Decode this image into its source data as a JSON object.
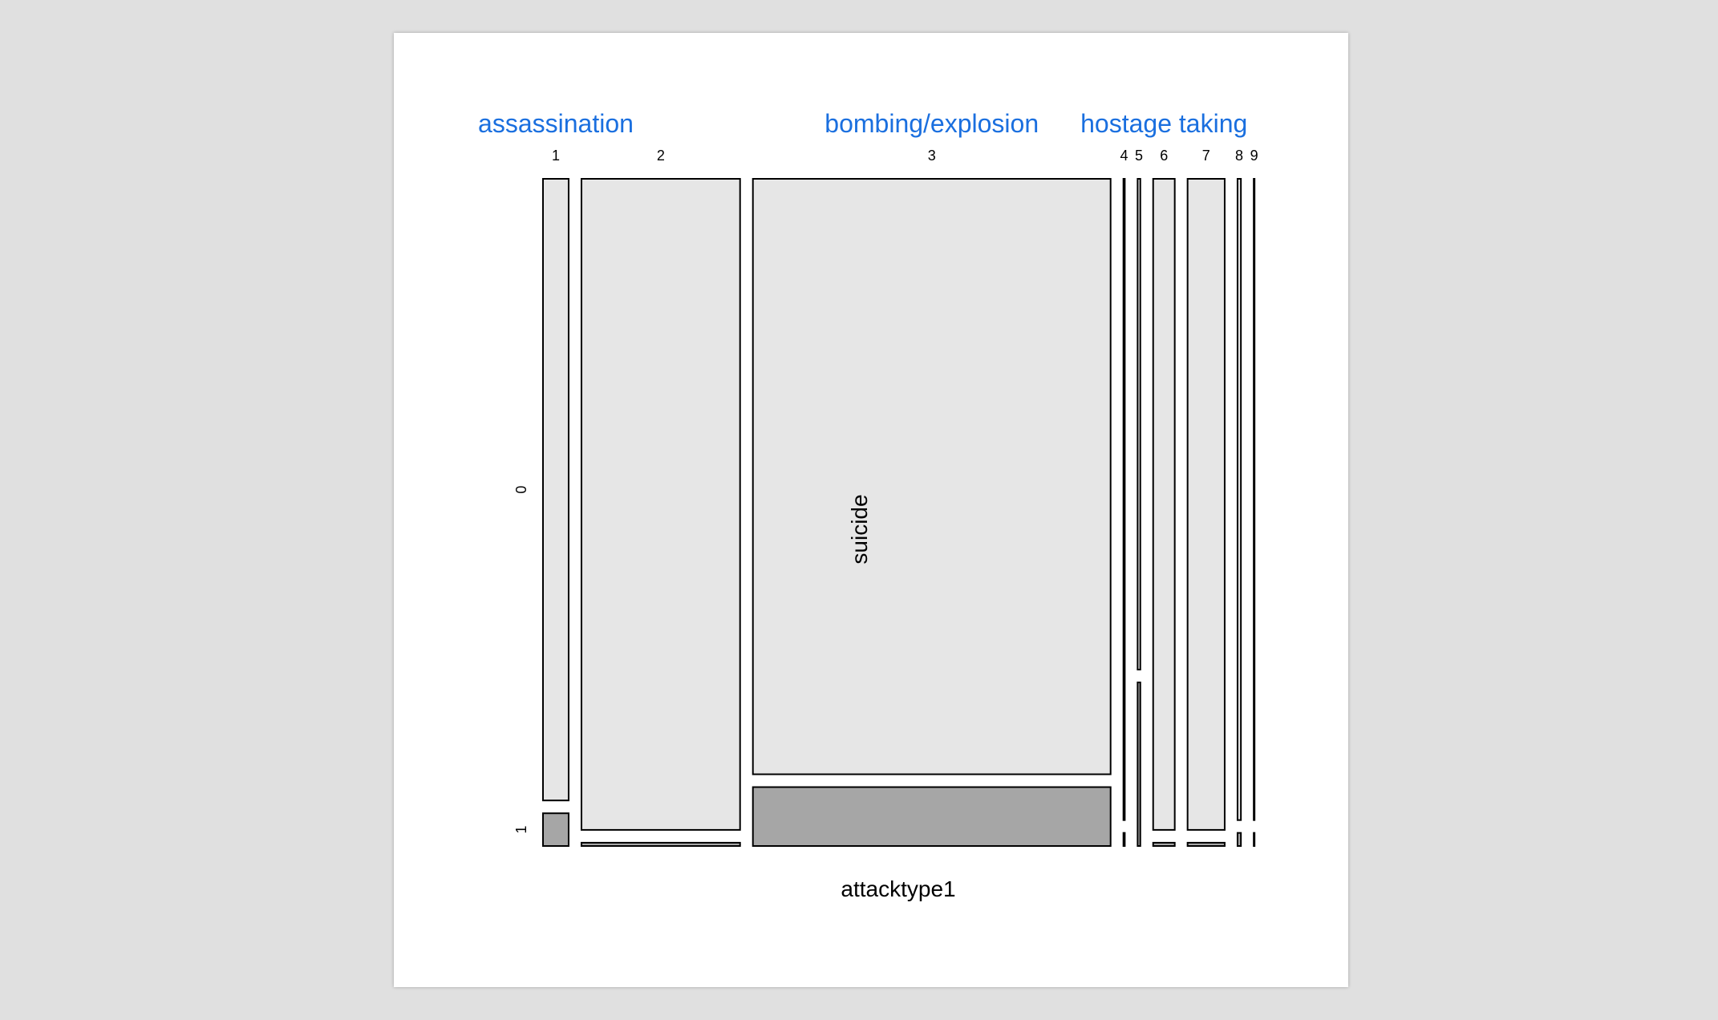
{
  "chart_data": {
    "type": "mosaic",
    "xlabel": "attacktype1",
    "ylabel": "suicide",
    "x_categories": [
      "1",
      "2",
      "3",
      "4",
      "5",
      "6",
      "7",
      "8",
      "9"
    ],
    "y_categories": [
      "0",
      "1"
    ],
    "x_shares": [
      0.038,
      0.235,
      0.53,
      0.002,
      0.004,
      0.032,
      0.055,
      0.005,
      0.001
    ],
    "suicide_share": [
      0.05,
      0.005,
      0.09,
      0.02,
      0.25,
      0.005,
      0.005,
      0.02,
      0.02
    ],
    "annotations": [
      {
        "text": "assassination",
        "at_category": "1"
      },
      {
        "text": "bombing/explosion",
        "at_category": "3"
      },
      {
        "text": "hostage taking",
        "at_category": "6"
      }
    ],
    "colors": {
      "suicide_0": "#e6e6e6",
      "suicide_1": "#a6a6a6",
      "outline": "#000000",
      "annotation": "#1a6fdf",
      "text": "#000000"
    }
  }
}
